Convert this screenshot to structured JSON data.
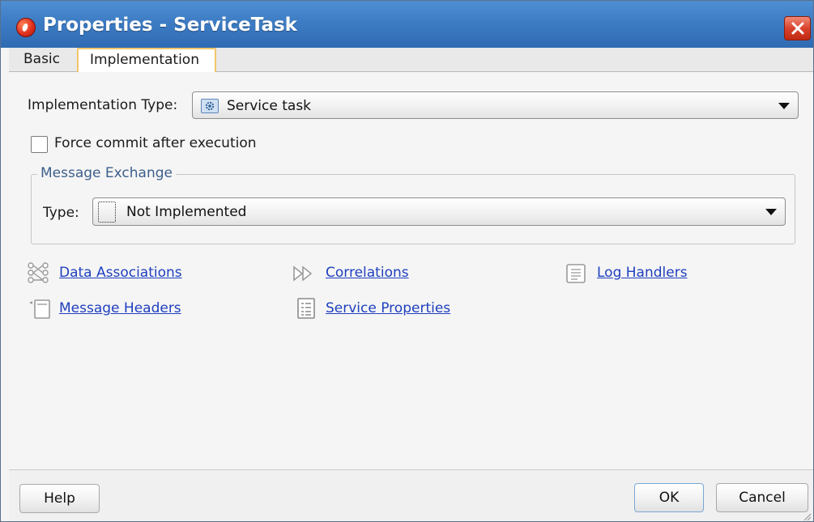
{
  "window": {
    "title": "Properties - ServiceTask"
  },
  "tabs": [
    {
      "label": "Basic",
      "active": false
    },
    {
      "label": "Implementation",
      "active": true
    }
  ],
  "implementation": {
    "type_label": "Implementation Type:",
    "type_value": "Service task",
    "type_icon": "gear-icon",
    "force_commit_label": "Force commit after execution",
    "force_commit_checked": false
  },
  "message_exchange": {
    "legend": "Message Exchange",
    "type_label": "Type:",
    "type_value": "Not Implemented",
    "type_icon": "dotted-box-icon"
  },
  "links": [
    {
      "label": "Data Associations",
      "icon": "data-associations-icon"
    },
    {
      "label": "Correlations",
      "icon": "correlations-icon"
    },
    {
      "label": "Log Handlers",
      "icon": "log-handlers-icon"
    },
    {
      "label": "Message Headers",
      "icon": "message-headers-icon"
    },
    {
      "label": "Service Properties",
      "icon": "service-properties-icon"
    }
  ],
  "buttons": {
    "help": "Help",
    "ok": "OK",
    "cancel": "Cancel"
  },
  "colors": {
    "titlebar": "#3d7cc4",
    "link": "#1f3fbf",
    "active_tab_border": "#f2c56a",
    "legend_text": "#3d5f8c",
    "close_button": "#d9432c"
  }
}
